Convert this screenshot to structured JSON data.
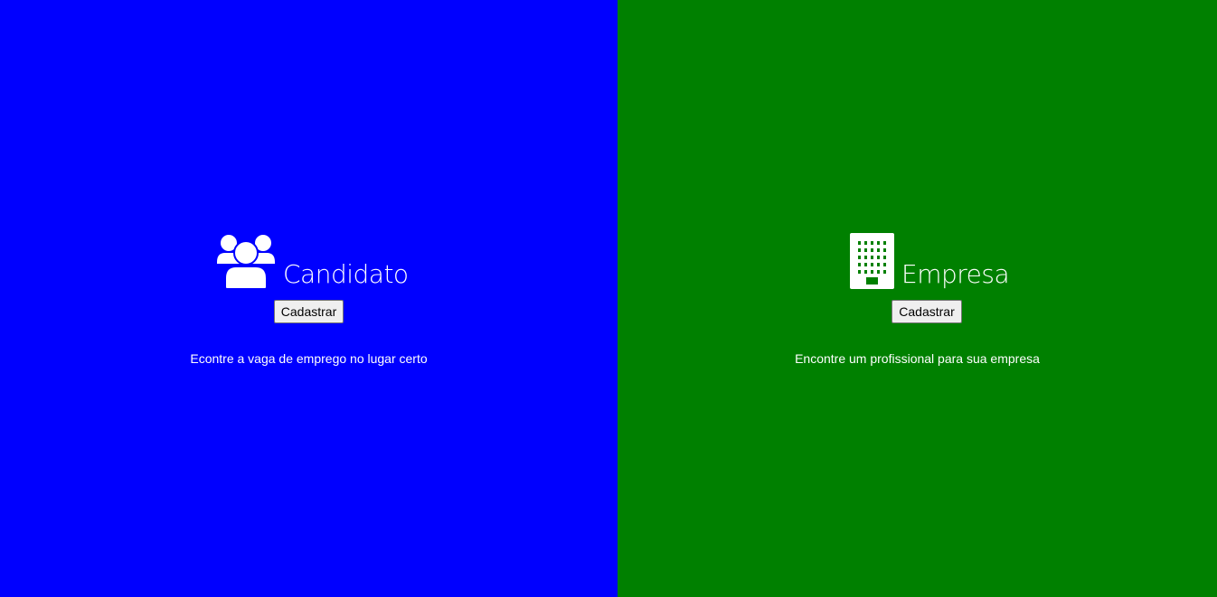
{
  "colors": {
    "candidate_bg": "#0000ff",
    "company_bg": "#008000",
    "text": "#ffffff"
  },
  "candidate": {
    "icon": "people-group-icon",
    "title": "Candidato",
    "button_label": "Cadastrar",
    "tagline": "Econtre a vaga de emprego no lugar certo"
  },
  "company": {
    "icon": "building-icon",
    "title": "Empresa",
    "button_label": "Cadastrar",
    "tagline": "Encontre um profissional para sua empresa"
  }
}
